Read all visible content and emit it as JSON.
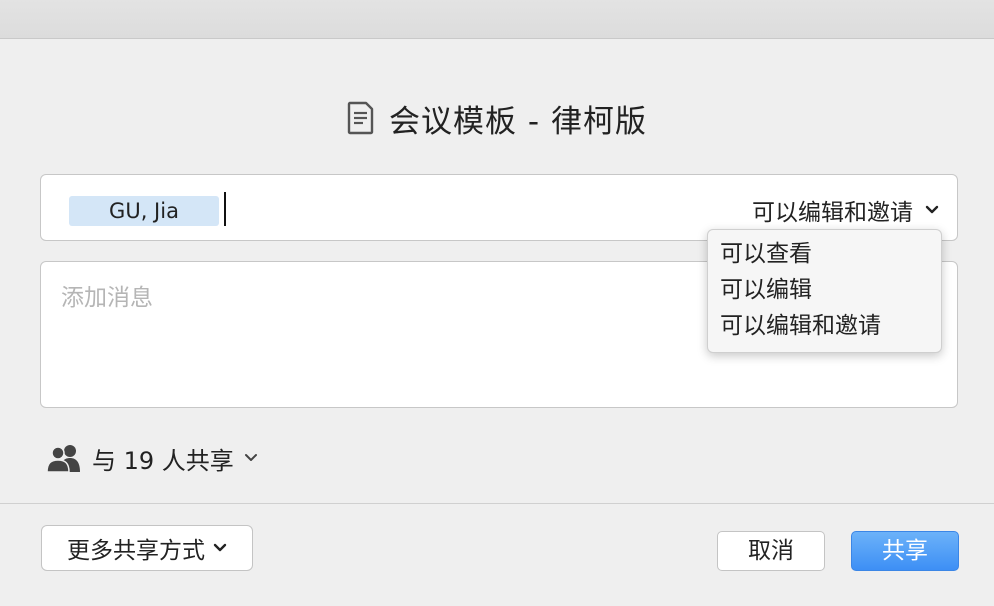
{
  "dialog": {
    "title": "会议模板 - 律柯版",
    "title_icon": "document-icon"
  },
  "recipients": {
    "chips": [
      "GU, Jia"
    ],
    "permission_selected": "可以编辑和邀请"
  },
  "permission_menu": {
    "options": [
      "可以查看",
      "可以编辑",
      "可以编辑和邀请"
    ]
  },
  "message": {
    "placeholder": "添加消息",
    "value": ""
  },
  "sharing": {
    "count_label": "与 19 人共享",
    "icon": "people-icon"
  },
  "footer": {
    "more_label": "更多共享方式",
    "cancel_label": "取消",
    "share_label": "共享"
  },
  "colors": {
    "accent": "#3d8ff5",
    "chip_bg": "#d4e6f7",
    "placeholder": "#b5b5b5"
  }
}
